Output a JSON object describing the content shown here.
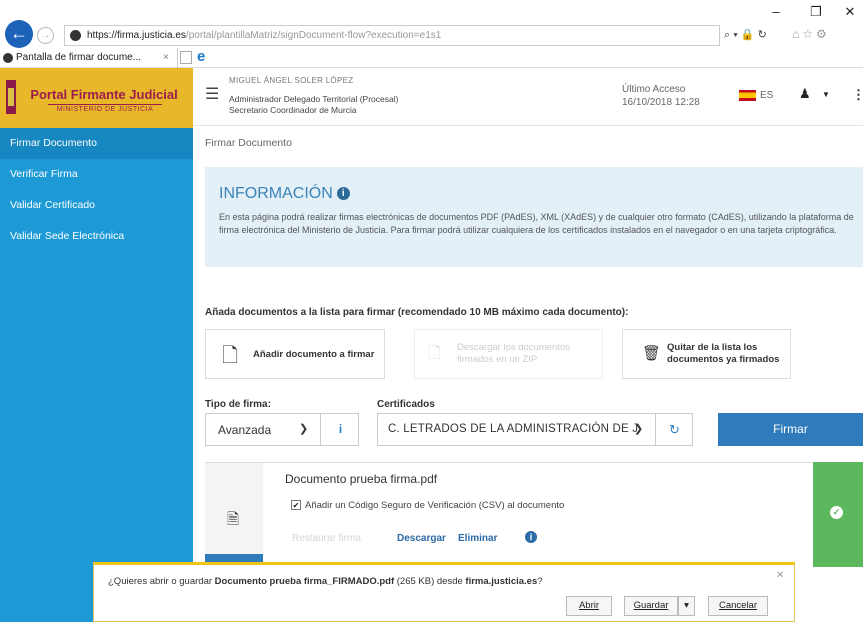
{
  "browser": {
    "url_host": "https://firma.justicia.es",
    "url_path": "/portal/plantillaMatriz/signDocument-flow?execution=e1s1",
    "url_tools": "⌕ ▾ 🔒 ↻",
    "tab_title": "Pantalla de firmar docume...",
    "tab_close": "×",
    "window_minimize": "–",
    "window_restore": "❐",
    "window_close": "✕"
  },
  "sidebar": {
    "logo_title": "Portal Firmante Judicial",
    "logo_subtitle": "MINISTERIO DE JUSTICIA",
    "items": [
      {
        "label": "Firmar Documento"
      },
      {
        "label": "Verificar Firma"
      },
      {
        "label": "Validar Certificado"
      },
      {
        "label": "Validar Sede Electrónica"
      }
    ]
  },
  "header": {
    "user_name": "MIGUEL ÁNGEL SOLER LÓPEZ",
    "user_role1": "Administrador Delegado Territorial (Procesal)",
    "user_role2": "Secretario Coordinador de Murcia",
    "last_access_label": "Último Acceso",
    "last_access_value": "16/10/2018 12:28",
    "lang": "ES"
  },
  "breadcrumb": "Firmar Documento",
  "info": {
    "title": "INFORMACIÓN",
    "text": "En esta página podrá realizar firmas electrónicas de documentos PDF (PAdES), XML (XAdES) y de cualquier otro formato (CAdES), utilizando la plataforma de firma electrónica del Ministerio de Justicia. Para firmar podrá utilizar cualquiera de los certificados instalados en el navegador o en una tarjeta criptográfica."
  },
  "documents": {
    "add_title": "Añada documentos a la lista para firmar (recomendado 10 MB máximo cada documento):",
    "add_button": "Añadir documento a firmar",
    "download_line1": "Descargar los documentos",
    "download_line2": "firmados en un ZIP",
    "remove_line1": "Quitar de la lista los",
    "remove_line2": "documentos ya firmados"
  },
  "form": {
    "tipo_label": "Tipo de firma:",
    "tipo_value": "Avanzada",
    "cert_label": "Certificados",
    "cert_value": "C. LETRADOS DE LA ADMINISTRACIÓN DE J",
    "sign_button": "Firmar"
  },
  "document_item": {
    "name": "Documento prueba firma.pdf",
    "csv_label": "Añadir un Código Seguro de Verificación (CSV) al documento",
    "csv_checked": true,
    "action_restore": "Restaurar firma",
    "action_download": "Descargar",
    "action_delete": "Eliminar"
  },
  "download_bar": {
    "prefix": "¿Quieres abrir o guardar ",
    "file_name": "Documento prueba firma_FIRMADO.pdf",
    "size": " (265 KB) desde ",
    "source": "firma.justicia.es",
    "suffix": "?",
    "open_button": "Abrir",
    "save_button": "Guardar",
    "cancel_button": "Cancelar"
  },
  "colors": {
    "sidebar_bg": "#1d9ad6",
    "logo_bg": "#e9b82a",
    "primary": "#2f7bbb",
    "success": "#5cb85c",
    "info_bg": "#e3f0f8"
  }
}
